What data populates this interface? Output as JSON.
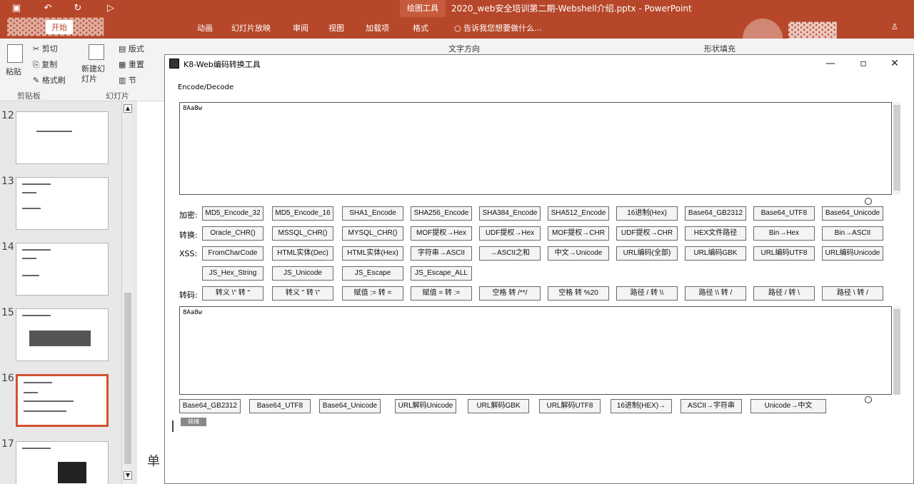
{
  "ppt": {
    "doc_title": "2020_web安全培训第二期-Webshell介绍.pptx - PowerPoint",
    "context_tab": "绘图工具",
    "tabs": [
      "开始",
      "动画",
      "幻灯片放映",
      "审阅",
      "视图",
      "加载项",
      "格式"
    ],
    "search": "告诉我您想要做什么...",
    "ribbon": {
      "cut": "剪切",
      "copy": "复制",
      "paste": "粘贴",
      "format_painter": "格式刷",
      "new_slide": "新建幻灯片",
      "layout": "版式",
      "reset": "重置",
      "section": "节",
      "clipboard_group": "剪贴板",
      "slides_group": "幻灯片",
      "shape_fill": "形状填充",
      "text_direction": "文字方向"
    },
    "slides": [
      {
        "num": "12"
      },
      {
        "num": "13"
      },
      {
        "num": "14"
      },
      {
        "num": "15"
      },
      {
        "num": "16"
      },
      {
        "num": "17"
      }
    ],
    "bg_text": "单"
  },
  "tool": {
    "title": "K8-Web编码转换工具",
    "group": "Encode/Decode",
    "input_text": "8Aa8w",
    "output_text": "8Aa8w",
    "rows": [
      {
        "label": "加密:",
        "buttons": [
          "MD5_Encode_32",
          "MD5_Encode_16",
          "SHA1_Encode",
          "SHA256_Encode",
          "SHA384_Encode",
          "SHA512_Encode",
          "16进制(Hex)",
          "Base64_GB2312",
          "Base64_UTF8",
          "Base64_Unicode"
        ]
      },
      {
        "label": "转换:",
        "buttons": [
          "Oracle_CHR()",
          "MSSQL_CHR()",
          "MYSQL_CHR()",
          "MOF提权→Hex",
          "UDF提权→Hex",
          "MOF提权→CHR",
          "UDF提权→CHR",
          "HEX文件路径",
          "Bin→Hex",
          "Bin→ASCII"
        ]
      },
      {
        "label": "XSS:",
        "buttons": [
          "FromCharCode",
          "HTML实体(Dec)",
          "HTML实体(Hex)",
          "字符串→ASCII",
          "→ASCII之和",
          "中文→Unicode",
          "URL编码(全部)",
          "URL编码GBK",
          "URL编码UTF8",
          "URL编码Unicode"
        ]
      },
      {
        "label": "",
        "buttons": [
          "JS_Hex_String",
          "JS_Unicode",
          "JS_Escape",
          "JS_Escape_ALL"
        ]
      },
      {
        "label": "转码:",
        "buttons": [
          "转义 \\\" 转 \"",
          "转义 \" 转 \\\"",
          "赋值 := 转 =",
          "赋值 = 转 :=",
          "空格 转 /**/",
          "空格 转 %20",
          "路径 / 转 \\\\",
          "路径 \\\\ 转 /",
          "路径 / 转 \\",
          "路径 \\ 转 /"
        ]
      }
    ],
    "decode_buttons": [
      "Base64_GB2312",
      "Base64_UTF8",
      "Base64_Unicode",
      "URL解码Unicode",
      "URL解码GBK",
      "URL解码UTF8",
      "16进制(HEX)→",
      "ASCII→字符串",
      "Unicode→中文"
    ],
    "status": "就绪"
  }
}
